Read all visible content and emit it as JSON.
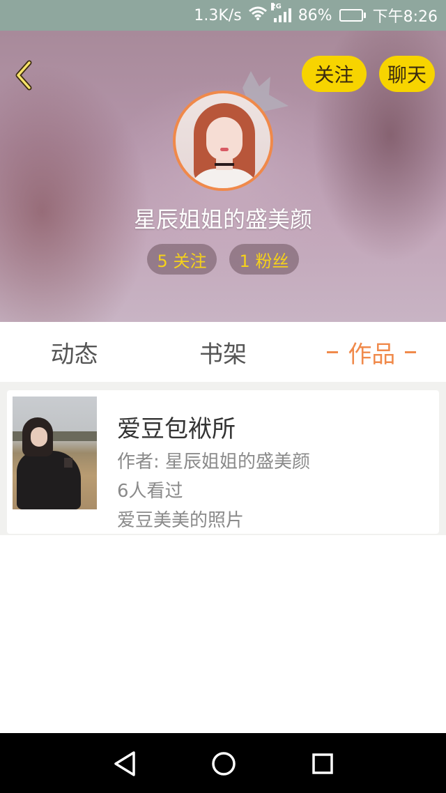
{
  "status_bar": {
    "network_speed": "1.3K/s",
    "network_type": "2G",
    "battery_percent": "86%",
    "battery_level": 0.86,
    "time": "下午8:26",
    "icons": [
      "wifi-icon",
      "signal-icon",
      "battery-icon"
    ]
  },
  "header": {
    "back_icon": "chevron-left-icon",
    "follow_label": "关注",
    "chat_label": "聊天",
    "username": "星辰姐姐的盛美颜",
    "stats": {
      "following": "5 关注",
      "fans": "1 粉丝"
    }
  },
  "tabs": [
    {
      "label": "动态",
      "active": false
    },
    {
      "label": "书架",
      "active": false
    },
    {
      "label": "作品",
      "active": true
    }
  ],
  "works": [
    {
      "title": "爱豆包袱所",
      "author": "作者: 星辰姐姐的盛美颜",
      "views": "6人看过",
      "description": "爱豆美美的照片"
    }
  ],
  "nav_bar": {
    "icons": [
      "back-triangle-icon",
      "home-circle-icon",
      "recents-square-icon"
    ]
  },
  "colors": {
    "accent_yellow": "#f7d400",
    "accent_orange": "#f08a4b",
    "status_bar": "#8fa79e"
  }
}
